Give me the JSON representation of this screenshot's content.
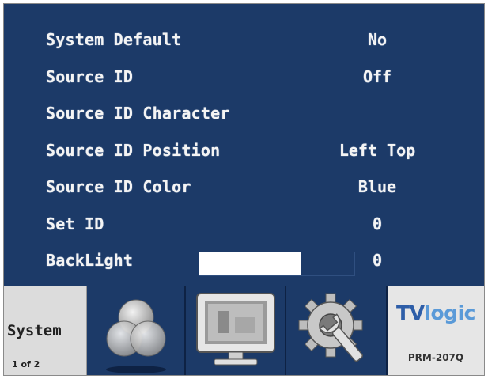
{
  "menu": {
    "items": [
      {
        "label": "System Default",
        "value": "No"
      },
      {
        "label": "Source ID",
        "value": "Off"
      },
      {
        "label": "Source ID Character",
        "value": ""
      },
      {
        "label": "Source ID Position",
        "value": "Left Top"
      },
      {
        "label": "Source ID Color",
        "value": "Blue"
      },
      {
        "label": "Set ID",
        "value": "0"
      },
      {
        "label": "BackLight",
        "value": "0",
        "level_fraction": 0.66
      }
    ]
  },
  "bottom_bar": {
    "current_menu": "System",
    "page_indicator": "1 of 2",
    "tabs": [
      {
        "icon": "color-circles-icon"
      },
      {
        "icon": "monitor-icon"
      },
      {
        "icon": "gear-wrench-icon"
      }
    ],
    "brand": {
      "tv": "TV",
      "logic": "logic"
    },
    "model": "PRM-207Q"
  },
  "colors": {
    "menu_background": "#1c3a68",
    "text": "#f4f4f4",
    "bottom_bar": "#cfcfcf",
    "brand_dark": "#2e5ea8",
    "brand_light": "#5a9ad8"
  }
}
